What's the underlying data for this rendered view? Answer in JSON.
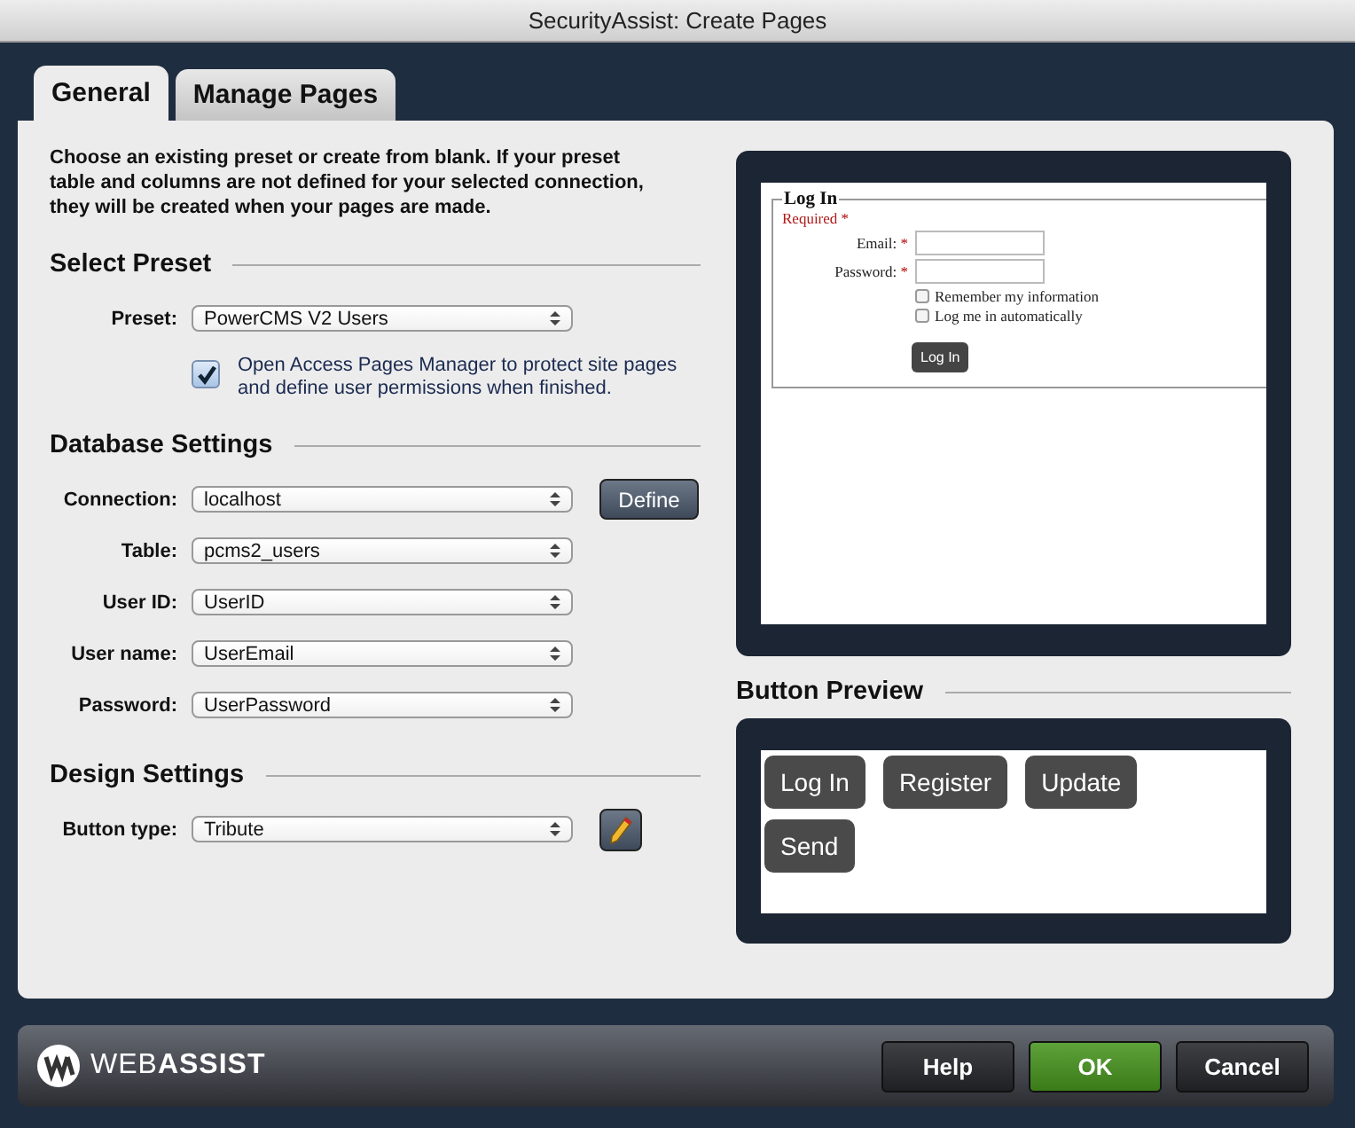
{
  "window": {
    "title": "SecurityAssist: Create Pages"
  },
  "tabs": [
    {
      "label": "General",
      "selected": true
    },
    {
      "label": "Manage Pages",
      "selected": false
    }
  ],
  "intro": "Choose an existing preset or create from blank. If your preset table and columns are not defined for your selected connection, they will be created when your pages are made.",
  "sections": [
    {
      "heading": "Select Preset",
      "rows": [
        {
          "kind": "select",
          "label": "Preset:",
          "value": "PowerCMS V2 Users"
        },
        {
          "kind": "checkbox",
          "label": "Open Access Pages Manager to protect site pages and define user permissions when finished.",
          "checked": true
        }
      ]
    },
    {
      "heading": "Database Settings",
      "rows": [
        {
          "kind": "select",
          "label": "Connection:",
          "value": "localhost",
          "button": "Define"
        },
        {
          "kind": "select",
          "label": "Table:",
          "value": "pcms2_users"
        },
        {
          "kind": "select",
          "label": "User ID:",
          "value": "UserID"
        },
        {
          "kind": "select",
          "label": "User name:",
          "value": "UserEmail"
        },
        {
          "kind": "select",
          "label": "Password:",
          "value": "UserPassword"
        }
      ]
    },
    {
      "heading": "Design Settings",
      "rows": [
        {
          "kind": "select",
          "label": "Button type:",
          "value": "Tribute",
          "edit": true
        }
      ]
    }
  ],
  "page_preview": {
    "legend": "Log In",
    "required": "Required",
    "required_mark": "*",
    "fields": [
      {
        "label": "Email:",
        "mark": "*"
      },
      {
        "label": "Password:",
        "mark": "*"
      }
    ],
    "options": [
      {
        "label": "Remember my information",
        "checked": false
      },
      {
        "label": "Log me in automatically",
        "checked": false
      }
    ],
    "button": "Log In"
  },
  "button_preview": {
    "heading": "Button Preview",
    "buttons": [
      "Log In",
      "Register",
      "Update",
      "Send"
    ]
  },
  "footer": {
    "logo": "WEB**ASSIST**",
    "buttons": [
      {
        "label": "Help",
        "kind": "normal"
      },
      {
        "label": "OK",
        "kind": "primary"
      },
      {
        "label": "Cancel",
        "kind": "normal"
      }
    ]
  }
}
